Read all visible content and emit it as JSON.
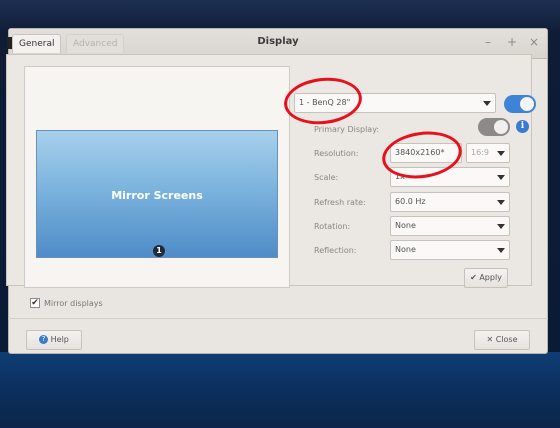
{
  "window": {
    "title": "Display",
    "controls": {
      "minimize": "–",
      "maximize": "+",
      "close": "×"
    }
  },
  "tabs": [
    {
      "label": "General",
      "active": true
    },
    {
      "label": "Advanced",
      "active": false
    }
  ],
  "preview": {
    "label": "Mirror Screens",
    "monitor_number": "1"
  },
  "display_select": {
    "value": "1 - BenQ 28\""
  },
  "display_enabled": true,
  "primary_display": {
    "label": "Primary Display:",
    "on": false
  },
  "settings": {
    "resolution": {
      "label": "Resolution:",
      "value": "3840x2160*",
      "aspect": "16:9"
    },
    "scale": {
      "label": "Scale:",
      "value": "1x"
    },
    "refresh_rate": {
      "label": "Refresh rate:",
      "value": "60.0 Hz"
    },
    "rotation": {
      "label": "Rotation:",
      "value": "None"
    },
    "reflection": {
      "label": "Reflection:",
      "value": "None"
    }
  },
  "apply_button": {
    "label": "Apply",
    "icon": "check-icon"
  },
  "mirror_checkbox": {
    "label": "Mirror displays",
    "checked": true,
    "mark": "✔"
  },
  "help_button": {
    "label": "Help",
    "icon": "help-icon"
  },
  "close_button": {
    "label": "Close",
    "icon": "close-icon"
  },
  "colors": {
    "accent": "#3d84d6",
    "annotation": "#e8101c"
  }
}
